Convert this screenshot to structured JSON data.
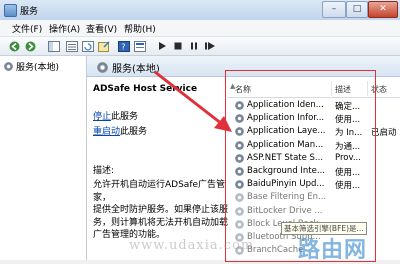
{
  "window": {
    "title": "服务",
    "minimize_icon": "minimize-icon",
    "maximize_icon": "maximize-icon",
    "close_icon": "close-icon"
  },
  "menu": [
    "文件(F)",
    "操作(A)",
    "查看(V)",
    "帮助(H)"
  ],
  "toolbar_icons": [
    "back-icon",
    "forward-icon",
    "show-tree-icon",
    "list-icon",
    "refresh-icon",
    "export-icon",
    "help-icon",
    "properties-icon",
    "start-icon",
    "stop-icon",
    "pause-icon",
    "restart-icon"
  ],
  "tree": {
    "root_label": "服务(本地)"
  },
  "main": {
    "header_title": "服务(本地)",
    "service_name": "ADSafe Host Service",
    "stop_link": "停止",
    "stop_rest": "此服务",
    "restart_link": "重启动",
    "restart_rest": "此服务",
    "desc_label": "描述:",
    "desc_lines": [
      "允许开机自动运行ADSafe广告管家，",
      "提供全时防护服务。如果停止该服",
      "务，则计算机将无法开机自动加载",
      "广告管理的功能。"
    ]
  },
  "columns": {
    "name": "名称",
    "desc": "描述",
    "status": "状态"
  },
  "services": [
    {
      "name": "Application Iden...",
      "desc": "确定...",
      "status": ""
    },
    {
      "name": "Application Infor...",
      "desc": "使用...",
      "status": ""
    },
    {
      "name": "Application Laye...",
      "desc": "为 In...",
      "status": "已启动"
    },
    {
      "name": "Application Man...",
      "desc": "为通...",
      "status": ""
    },
    {
      "name": "ASP.NET State S...",
      "desc": "Prov...",
      "status": ""
    },
    {
      "name": "Background Inte...",
      "desc": "使用...",
      "status": ""
    },
    {
      "name": "BaiduPinyin Upd...",
      "desc": "使用...",
      "status": ""
    },
    {
      "name": "Base Filtering En...",
      "desc": "",
      "status": ""
    },
    {
      "name": "BitLocker Drive ...",
      "desc": "",
      "status": ""
    },
    {
      "name": "Block Level Back...",
      "desc": "",
      "status": ""
    },
    {
      "name": "Bluetooth Supp...",
      "desc": "",
      "status": ""
    },
    {
      "name": "BranchCache",
      "desc": "",
      "status": ""
    }
  ],
  "tooltip": "基本筛选引擎(BFE)是...",
  "watermark_left": "www.udaxia.com",
  "watermark_right": "路由网",
  "colors": {
    "highlight_red": "#e0313a",
    "link_blue": "#0645ad"
  }
}
